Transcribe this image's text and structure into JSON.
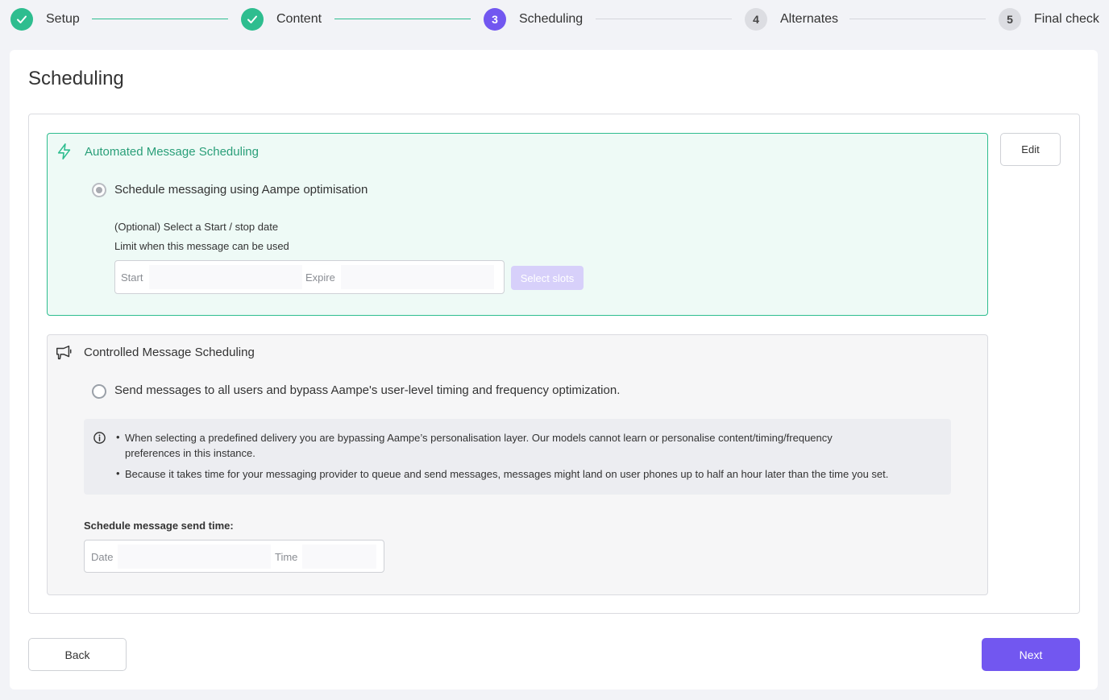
{
  "stepper": {
    "steps": [
      {
        "number": "1",
        "label": "Setup",
        "state": "done"
      },
      {
        "number": "2",
        "label": "Content",
        "state": "done"
      },
      {
        "number": "3",
        "label": "Scheduling",
        "state": "active"
      },
      {
        "number": "4",
        "label": "Alternates",
        "state": "todo"
      },
      {
        "number": "5",
        "label": "Final check",
        "state": "todo"
      }
    ]
  },
  "page": {
    "title": "Scheduling"
  },
  "automated": {
    "icon": "lightning-icon",
    "title": "Automated Message Scheduling",
    "radio_label": "Schedule messaging using Aampe optimisation",
    "radio_checked": true,
    "optional_text": "(Optional) Select a Start / stop date",
    "limit_text": "Limit when this message can be used",
    "start_label": "Start",
    "expire_label": "Expire",
    "select_slots_label": "Select slots"
  },
  "edit_label": "Edit",
  "controlled": {
    "icon": "megaphone-icon",
    "title": "Controlled Message Scheduling",
    "radio_label": "Send messages to all users and bypass Aampe's user-level timing and frequency optimization.",
    "radio_checked": false,
    "info": {
      "icon": "info-icon",
      "bullet1_line1": "When selecting a predefined delivery you are bypassing Aampe’s personalisation layer. Our models cannot learn or personalise content/timing/frequency",
      "bullet1_line2": "preferences in this instance.",
      "bullet2": "Because it takes time for your messaging provider to queue and send messages, messages might land on user phones up to half an hour later than the time you set."
    },
    "send_time_label": "Schedule message send time:",
    "date_label": "Date",
    "time_label": "Time"
  },
  "footer": {
    "back_label": "Back",
    "next_label": "Next"
  },
  "colors": {
    "accent": "#7257f0",
    "success": "#2ebd8f",
    "background": "#f2f3f7"
  }
}
